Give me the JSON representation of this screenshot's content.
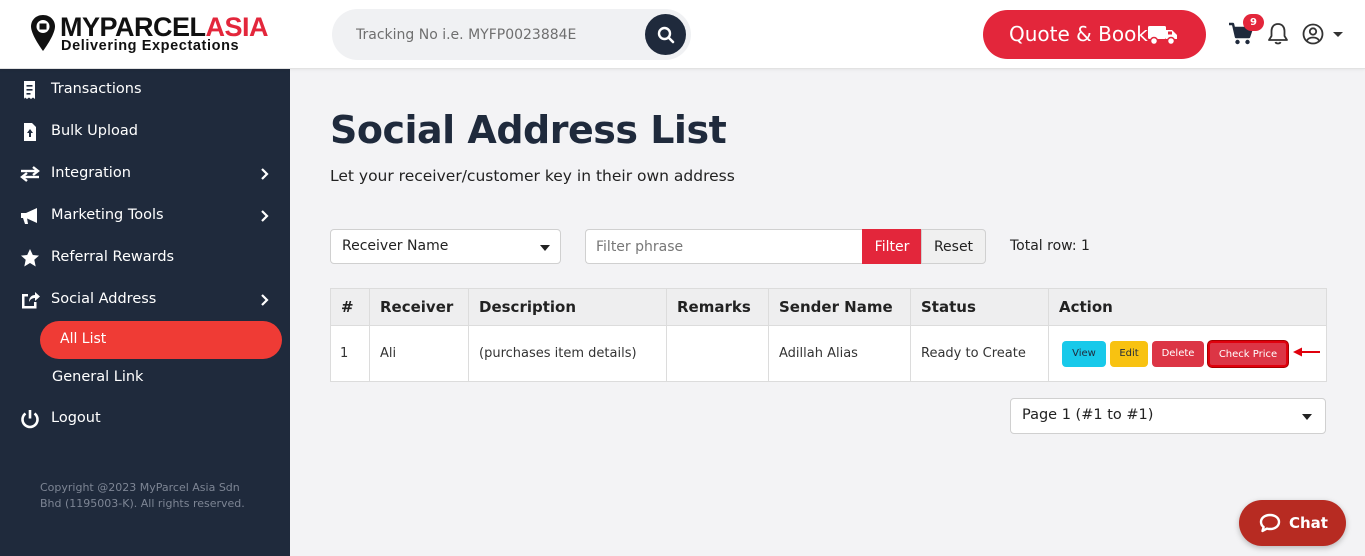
{
  "brand": {
    "name_part1": "MYPARCEL",
    "name_part2": "ASIA",
    "tagline": "Delivering Expectations",
    "colors": {
      "primary": "#e3263b",
      "sidebar_bg": "#1f2a3c",
      "active_item": "#ef3b35"
    }
  },
  "header": {
    "search_placeholder": "Tracking No i.e. MYFP0023884E",
    "quote_label": "Quote & Book",
    "cart_count": "9",
    "icons": [
      "search-icon",
      "truck-icon",
      "cart-icon",
      "bell-icon",
      "user-circle-icon",
      "caret-down-icon"
    ]
  },
  "sidebar": {
    "items": [
      {
        "label": "Transactions",
        "icon": "receipt-icon",
        "has_submenu": false
      },
      {
        "label": "Bulk Upload",
        "icon": "file-upload-icon",
        "has_submenu": false
      },
      {
        "label": "Integration",
        "icon": "exchange-icon",
        "has_submenu": true
      },
      {
        "label": "Marketing Tools",
        "icon": "megaphone-icon",
        "has_submenu": true
      },
      {
        "label": "Referral Rewards",
        "icon": "star-icon",
        "has_submenu": false
      },
      {
        "label": "Social Address",
        "icon": "share-square-icon",
        "has_submenu": true
      }
    ],
    "sub_items": [
      {
        "label": "All List",
        "active": true
      },
      {
        "label": "General Link",
        "active": false
      }
    ],
    "logout_label": "Logout",
    "copyright": "Copyright @2023 MyParcel Asia Sdn Bhd (1195003-K). All rights reserved."
  },
  "main": {
    "title": "Social Address List",
    "subtitle": "Let your receiver/customer key in their own address",
    "filter": {
      "field_selected": "Receiver Name",
      "phrase_placeholder": "Filter phrase",
      "filter_label": "Filter",
      "reset_label": "Reset",
      "total_text": "Total row: 1"
    },
    "table": {
      "columns": [
        "#",
        "Receiver",
        "Description",
        "Remarks",
        "Sender Name",
        "Status",
        "Action"
      ],
      "rows": [
        {
          "no": "1",
          "receiver": "Ali",
          "description": "(purchases item details)",
          "remarks": "",
          "sender_name": "Adillah Alias",
          "status": "Ready to Create"
        }
      ],
      "actions": {
        "view": "View",
        "edit": "Edit",
        "delete": "Delete",
        "check_price": "Check Price"
      }
    },
    "pagination_label": "Page 1 (#1 to #1)"
  },
  "chat": {
    "label": "Chat"
  }
}
